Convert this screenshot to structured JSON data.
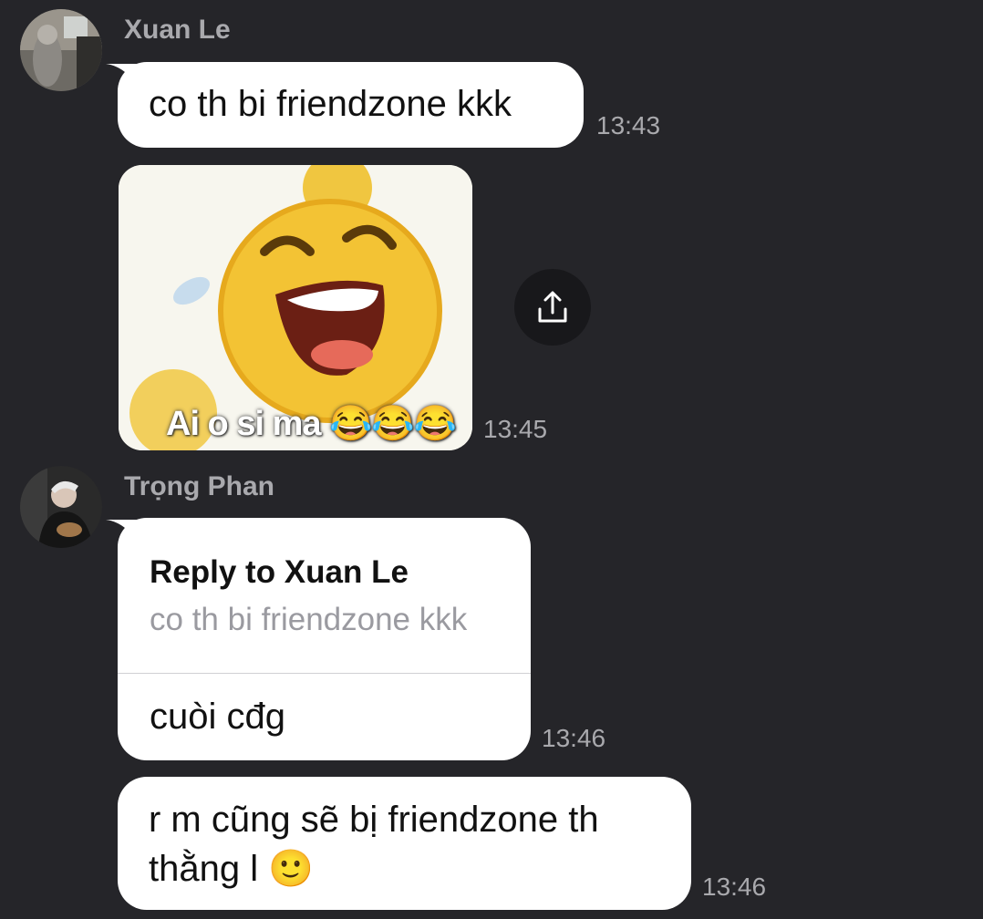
{
  "colors": {
    "background": "#252529",
    "bubble": "#ffffff",
    "meta_text": "#a9a9ad"
  },
  "messages": [
    {
      "sender": "Xuan Le",
      "avatar_icon": "user-avatar-photo",
      "text": "co th bi friendzone kkk",
      "time": "13:43"
    },
    {
      "sender": "Xuan Le",
      "type": "image",
      "image_caption": "Ai o si ma 😂😂😂",
      "share_icon": "share-icon",
      "time": "13:45"
    },
    {
      "sender": "Trọng Phan",
      "avatar_icon": "user-avatar-photo",
      "reply_label": "Reply to Xuan Le",
      "reply_quote": "co th bi friendzone kkk",
      "text": "cuòi cđg",
      "time": "13:46"
    },
    {
      "sender": "Trọng Phan",
      "text_line1": "r m cũng sẽ bị friendzone th",
      "text_line2": "thằng l 🙂",
      "time": "13:46"
    }
  ]
}
